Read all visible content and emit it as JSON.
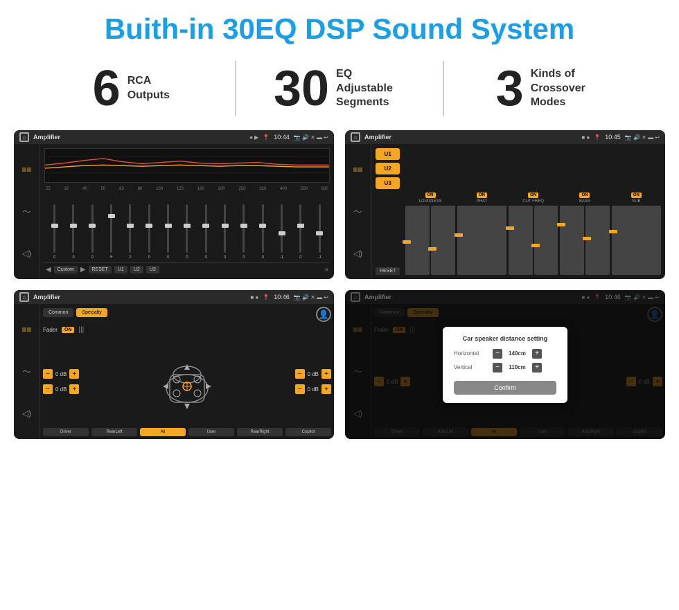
{
  "header": {
    "title": "Buith-in 30EQ DSP Sound System"
  },
  "stats": [
    {
      "number": "6",
      "label": "RCA\nOutputs"
    },
    {
      "number": "30",
      "label": "EQ Adjustable\nSegments"
    },
    {
      "number": "3",
      "label": "Kinds of\nCrossover Modes"
    }
  ],
  "screens": [
    {
      "id": "screen1",
      "statusBar": {
        "title": "Amplifier",
        "time": "10:44"
      },
      "type": "eq",
      "frequencies": [
        "25",
        "32",
        "40",
        "50",
        "63",
        "80",
        "100",
        "125",
        "160",
        "200",
        "250",
        "320",
        "400",
        "500",
        "630"
      ],
      "sliderValues": [
        "0",
        "0",
        "0",
        "5",
        "0",
        "0",
        "0",
        "0",
        "0",
        "0",
        "0",
        "0",
        "-1",
        "0",
        "-1"
      ],
      "buttons": [
        "Custom",
        "RESET",
        "U1",
        "U2",
        "U3"
      ]
    },
    {
      "id": "screen2",
      "statusBar": {
        "title": "Amplifier",
        "time": "10:45"
      },
      "type": "amplifier",
      "uButtons": [
        "U1",
        "U2",
        "U3"
      ],
      "channels": [
        {
          "label": "LOUDNESS",
          "on": true
        },
        {
          "label": "PHAT",
          "on": true
        },
        {
          "label": "CUT FREQ",
          "on": true
        },
        {
          "label": "BASS",
          "on": true
        },
        {
          "label": "SUB",
          "on": true
        }
      ],
      "resetBtn": "RESET"
    },
    {
      "id": "screen3",
      "statusBar": {
        "title": "Amplifier",
        "time": "10:46"
      },
      "type": "fader",
      "tabs": [
        "Common",
        "Specialty"
      ],
      "activeTab": "Specialty",
      "faderLabel": "Fader",
      "faderOn": "ON",
      "volumes": [
        "0 dB",
        "0 dB",
        "0 dB",
        "0 dB"
      ],
      "bottomButtons": [
        "Driver",
        "RearLeft",
        "All",
        "User",
        "RearRight",
        "Copilot"
      ]
    },
    {
      "id": "screen4",
      "statusBar": {
        "title": "Amplifier",
        "time": "10:46"
      },
      "type": "fader-dialog",
      "tabs": [
        "Common",
        "Specialty"
      ],
      "activeTab": "Specialty",
      "dialog": {
        "title": "Car speaker distance setting",
        "fields": [
          {
            "label": "Horizontal",
            "value": "140cm"
          },
          {
            "label": "Vertical",
            "value": "110cm"
          }
        ],
        "confirmBtn": "Confirm"
      },
      "volumes": [
        "0 dB",
        "0 dB"
      ],
      "bottomButtons": [
        "Driver",
        "RearLeft",
        "All",
        "User",
        "RearRight",
        "Copilot"
      ]
    }
  ]
}
